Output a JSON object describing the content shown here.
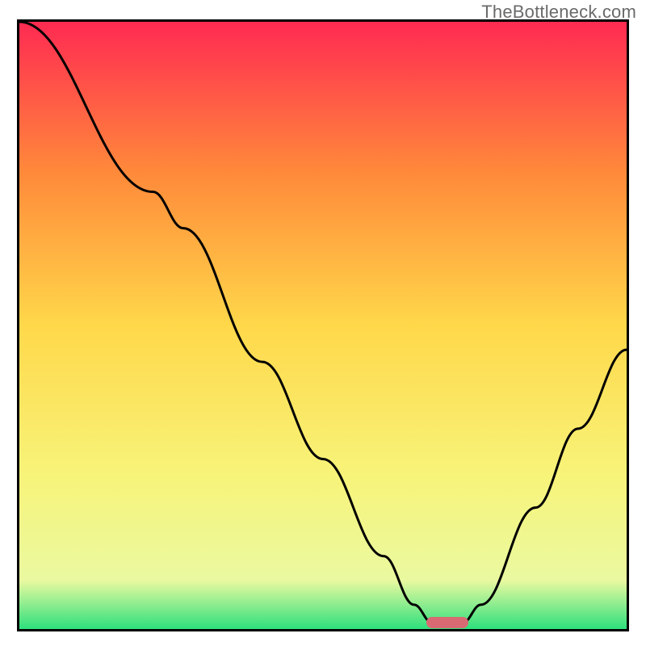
{
  "watermark": "TheBottleneck.com",
  "chart_data": {
    "type": "line",
    "title": "",
    "xlabel": "",
    "ylabel": "",
    "xlim": [
      0,
      100
    ],
    "ylim": [
      0,
      100
    ],
    "gradient_colors": {
      "top": "#ff2a52",
      "upper_mid": "#ff8a3a",
      "mid": "#ffd84a",
      "lower_mid": "#f7f47a",
      "low": "#eaf9a0",
      "bottom": "#2ee07d"
    },
    "curve": [
      {
        "x": 0,
        "y": 100
      },
      {
        "x": 22,
        "y": 72
      },
      {
        "x": 27,
        "y": 66
      },
      {
        "x": 40,
        "y": 44
      },
      {
        "x": 50,
        "y": 28
      },
      {
        "x": 60,
        "y": 12
      },
      {
        "x": 65,
        "y": 4
      },
      {
        "x": 68,
        "y": 1
      },
      {
        "x": 73,
        "y": 1
      },
      {
        "x": 76,
        "y": 4
      },
      {
        "x": 85,
        "y": 20
      },
      {
        "x": 92,
        "y": 33
      },
      {
        "x": 100,
        "y": 46
      }
    ],
    "minimum_bar": {
      "x_start": 67,
      "x_end": 74,
      "y": 1
    },
    "marker_color": "#d96a74"
  }
}
